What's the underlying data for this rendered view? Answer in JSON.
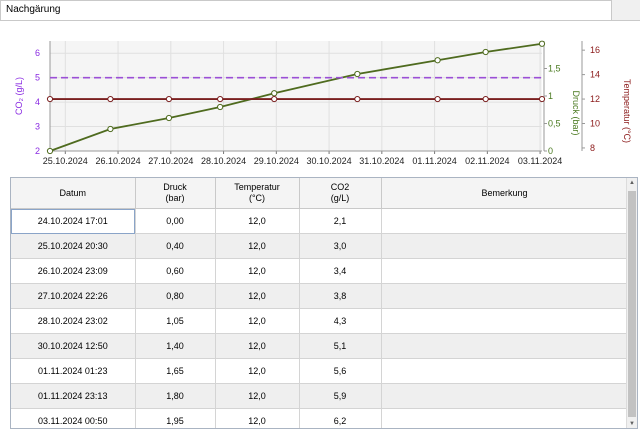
{
  "tab": {
    "title": "Nachgärung"
  },
  "chart_data": {
    "type": "line",
    "x": [
      "24.10.2024 17:01",
      "25.10.2024 20:30",
      "26.10.2024 23:09",
      "27.10.2024 22:26",
      "28.10.2024 23:02",
      "30.10.2024 12:50",
      "01.11.2024 01:23",
      "01.11.2024 23:13",
      "03.11.2024 00:50"
    ],
    "x_numeric_days": [
      0,
      1.145,
      2.255,
      3.225,
      4.25,
      5.826,
      7.347,
      8.258,
      9.326
    ],
    "x_ticks": [
      "25.10.2024",
      "26.10.2024",
      "27.10.2024",
      "28.10.2024",
      "29.10.2024",
      "30.10.2024",
      "31.10.2024",
      "01.11.2024",
      "02.11.2024",
      "03.11.2024"
    ],
    "x_tick_days": [
      0.29,
      1.29,
      2.29,
      3.29,
      4.29,
      5.29,
      6.29,
      7.29,
      8.29,
      9.29
    ],
    "axes": {
      "co2": {
        "label": "CO₂ (g/L)",
        "ylim": [
          2,
          6.5
        ],
        "ticks": [
          "2",
          "3",
          "4",
          "5",
          "6"
        ],
        "tick_values": [
          2,
          3,
          4,
          5,
          6
        ],
        "color": "#8a2be2"
      },
      "druck": {
        "label": "Druck (bar)",
        "ylim": [
          0,
          2.0
        ],
        "ticks": [
          "0",
          "0,5",
          "1",
          "1,5"
        ],
        "tick_values": [
          0,
          0.5,
          1,
          1.5
        ],
        "color": "#4a7a20"
      },
      "temp": {
        "label": "Temperatur (°C)",
        "ylim": [
          7.75,
          16.75
        ],
        "ticks": [
          "8",
          "10",
          "12",
          "14",
          "16"
        ],
        "tick_values": [
          8,
          10,
          12,
          14,
          16
        ],
        "color": "#8b1a1a"
      }
    },
    "series": [
      {
        "axis": "druck",
        "values": [
          0,
          0.4,
          0.6,
          0.8,
          1.05,
          1.4,
          1.65,
          1.8,
          1.95
        ],
        "color": "#4f6b1f",
        "style": "solid",
        "markers": true
      },
      {
        "axis": "temp",
        "values": [
          12,
          12,
          12,
          12,
          12,
          12,
          12,
          12,
          12
        ],
        "color": "#7a1f1f",
        "style": "solid",
        "markers": true
      },
      {
        "axis": "co2",
        "values": [
          5,
          5,
          5,
          5,
          5,
          5,
          5,
          5,
          5
        ],
        "color": "#9b4fd6",
        "style": "dashed",
        "markers": false
      }
    ],
    "grid": true
  },
  "table": {
    "columns": [
      {
        "l1": "Datum",
        "l2": ""
      },
      {
        "l1": "Druck",
        "l2": "(bar)"
      },
      {
        "l1": "Temperatur",
        "l2": "(°C)"
      },
      {
        "l1": "CO2",
        "l2": "(g/L)"
      },
      {
        "l1": "Bemerkung",
        "l2": ""
      }
    ],
    "rows": [
      [
        "24.10.2024 17:01",
        "0,00",
        "12,0",
        "2,1",
        ""
      ],
      [
        "25.10.2024 20:30",
        "0,40",
        "12,0",
        "3,0",
        ""
      ],
      [
        "26.10.2024 23:09",
        "0,60",
        "12,0",
        "3,4",
        ""
      ],
      [
        "27.10.2024 22:26",
        "0,80",
        "12,0",
        "3,8",
        ""
      ],
      [
        "28.10.2024 23:02",
        "1,05",
        "12,0",
        "4,3",
        ""
      ],
      [
        "30.10.2024 12:50",
        "1,40",
        "12,0",
        "5,1",
        ""
      ],
      [
        "01.11.2024 01:23",
        "1,65",
        "12,0",
        "5,6",
        ""
      ],
      [
        "01.11.2024 23:13",
        "1,80",
        "12,0",
        "5,9",
        ""
      ],
      [
        "03.11.2024 00:50",
        "1,95",
        "12,0",
        "6,2",
        ""
      ]
    ]
  }
}
